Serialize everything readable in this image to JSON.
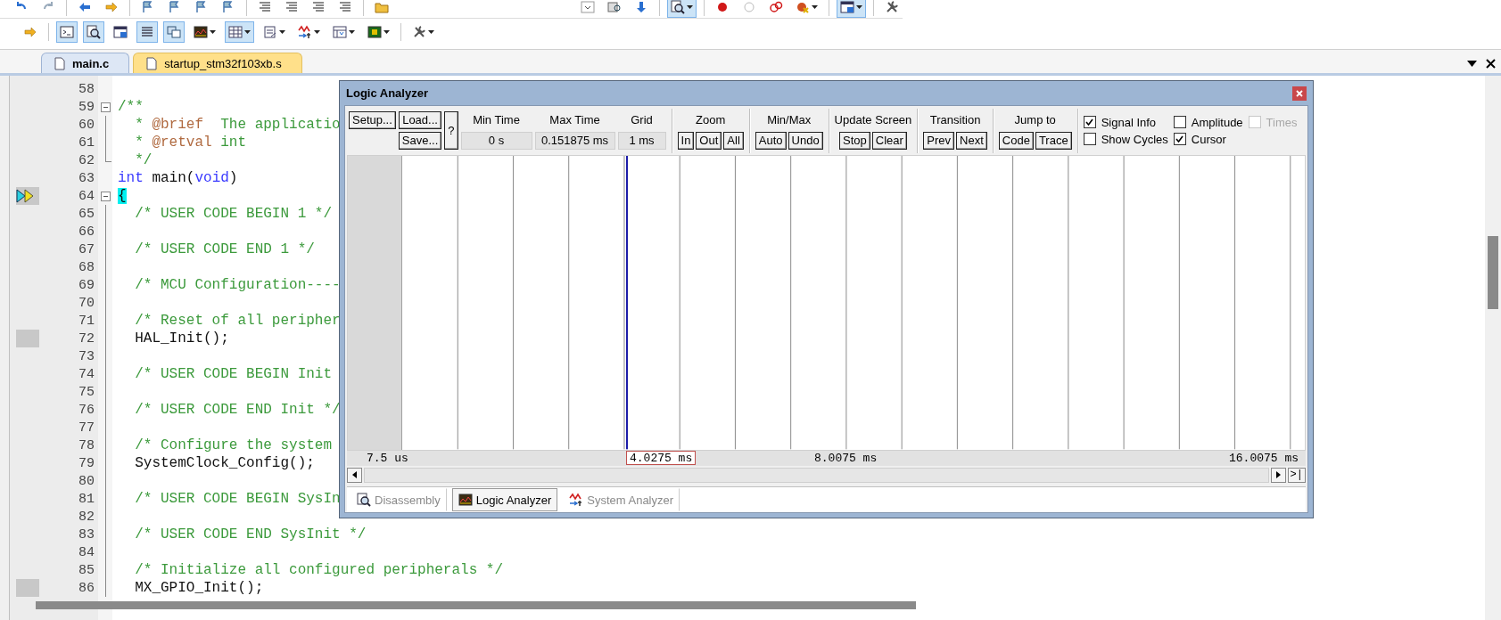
{
  "toolbar_top": {
    "left_groups": [
      [
        {
          "kind": "undo",
          "pressed": false
        },
        {
          "kind": "redo",
          "pressed": false
        }
      ],
      [
        {
          "kind": "back",
          "pressed": false
        },
        {
          "kind": "forward",
          "pressed": false
        }
      ],
      [
        {
          "kind": "flag",
          "pressed": false
        },
        {
          "kind": "flag",
          "pressed": false
        },
        {
          "kind": "flag",
          "pressed": false
        },
        {
          "kind": "flag",
          "pressed": false
        }
      ],
      [
        {
          "kind": "indent",
          "pressed": false
        },
        {
          "kind": "indent",
          "pressed": false
        },
        {
          "kind": "comment",
          "pressed": false
        },
        {
          "kind": "comment",
          "pressed": false
        }
      ],
      [
        {
          "kind": "folder",
          "pressed": false
        }
      ]
    ],
    "right_groups": [
      [
        {
          "kind": "combo",
          "pressed": false
        },
        {
          "kind": "find",
          "pressed": false
        },
        {
          "kind": "down",
          "pressed": false
        }
      ],
      [
        {
          "kind": "magnifier",
          "pressed": true,
          "dropdown": true
        }
      ],
      [
        {
          "kind": "dot",
          "pressed": false
        },
        {
          "kind": "ring",
          "pressed": false
        },
        {
          "kind": "rings",
          "pressed": false
        },
        {
          "kind": "bug",
          "pressed": false,
          "dropdown": true
        }
      ],
      [
        {
          "kind": "window",
          "pressed": true,
          "dropdown": true
        }
      ],
      [
        {
          "kind": "wrench",
          "pressed": false
        }
      ]
    ]
  },
  "toolbar_debug": [
    [
      {
        "kind": "forward",
        "pressed": false
      }
    ],
    [
      {
        "kind": "terminal",
        "pressed": true
      },
      {
        "kind": "magnifier",
        "pressed": true
      },
      {
        "kind": "window",
        "pressed": false
      },
      {
        "kind": "list",
        "pressed": true
      },
      {
        "kind": "windows",
        "pressed": true
      },
      {
        "kind": "chart",
        "pressed": false,
        "dropdown": true
      },
      {
        "kind": "grid",
        "pressed": true,
        "dropdown": true
      },
      {
        "kind": "document",
        "pressed": false,
        "dropdown": true
      },
      {
        "kind": "wave",
        "pressed": false,
        "dropdown": true
      },
      {
        "kind": "table",
        "pressed": false,
        "dropdown": true
      },
      {
        "kind": "chip",
        "pressed": false,
        "dropdown": true
      }
    ],
    [
      {
        "kind": "wrench",
        "pressed": false,
        "dropdown": true
      }
    ]
  ],
  "editor_tabs": [
    {
      "label": "main.c",
      "selected": true
    },
    {
      "label": "startup_stm32f103xb.s",
      "selected": false
    }
  ],
  "code_lines": [
    {
      "number": "58",
      "kind": "plain"
    },
    {
      "number": "59",
      "kind": "fold-start",
      "segments": [
        {
          "kind": "comment",
          "text": "/**"
        }
      ]
    },
    {
      "number": "60",
      "kind": "fold-body",
      "segments": [
        {
          "kind": "comment",
          "text": "  * "
        },
        {
          "kind": "doc-tag",
          "text": "@brief"
        },
        {
          "kind": "comment",
          "text": "  The applicatio"
        }
      ]
    },
    {
      "number": "61",
      "kind": "fold-body",
      "segments": [
        {
          "kind": "comment",
          "text": "  * "
        },
        {
          "kind": "doc-tag",
          "text": "@retval"
        },
        {
          "kind": "comment",
          "text": " int"
        }
      ]
    },
    {
      "number": "62",
      "kind": "fold-end",
      "segments": [
        {
          "kind": "comment",
          "text": "  */"
        }
      ]
    },
    {
      "number": "63",
      "kind": "plain",
      "segments": [
        {
          "kind": "keyword",
          "text": "int"
        },
        {
          "kind": "plain",
          "text": " main("
        },
        {
          "kind": "keyword",
          "text": "void"
        },
        {
          "kind": "plain",
          "text": ")"
        }
      ]
    },
    {
      "number": "64",
      "current_line": true,
      "kind": "fold-start",
      "segments": [
        {
          "kind": "brace-match",
          "text": "{"
        }
      ]
    },
    {
      "number": "65",
      "kind": "fold-body",
      "segments": [
        {
          "kind": "comment",
          "text": "  /* USER CODE BEGIN 1 */"
        }
      ]
    },
    {
      "number": "66",
      "kind": "fold-body"
    },
    {
      "number": "67",
      "kind": "fold-body",
      "segments": [
        {
          "kind": "comment",
          "text": "  /* USER CODE END 1 */"
        }
      ]
    },
    {
      "number": "68",
      "kind": "fold-body"
    },
    {
      "number": "69",
      "kind": "fold-body",
      "segments": [
        {
          "kind": "comment",
          "text": "  /* MCU Configuration----"
        }
      ]
    },
    {
      "number": "70",
      "kind": "fold-body"
    },
    {
      "number": "71",
      "kind": "fold-body",
      "segments": [
        {
          "kind": "comment",
          "text": "  /* Reset of all peripher"
        }
      ]
    },
    {
      "number": "72",
      "executable": true,
      "kind": "fold-body",
      "segments": [
        {
          "kind": "plain",
          "text": "  HAL_Init();"
        }
      ]
    },
    {
      "number": "73",
      "kind": "fold-body"
    },
    {
      "number": "74",
      "kind": "fold-body",
      "segments": [
        {
          "kind": "comment",
          "text": "  /* USER CODE BEGIN Init"
        }
      ]
    },
    {
      "number": "75",
      "kind": "fold-body"
    },
    {
      "number": "76",
      "kind": "fold-body",
      "segments": [
        {
          "kind": "comment",
          "text": "  /* USER CODE END Init */"
        }
      ]
    },
    {
      "number": "77",
      "kind": "fold-body"
    },
    {
      "number": "78",
      "kind": "fold-body",
      "segments": [
        {
          "kind": "comment",
          "text": "  /* Configure the system"
        }
      ]
    },
    {
      "number": "79",
      "kind": "fold-body",
      "segments": [
        {
          "kind": "plain",
          "text": "  SystemClock_Config();"
        }
      ]
    },
    {
      "number": "80",
      "kind": "fold-body"
    },
    {
      "number": "81",
      "kind": "fold-body",
      "segments": [
        {
          "kind": "comment",
          "text": "  /* USER CODE BEGIN SysIn"
        }
      ]
    },
    {
      "number": "82",
      "kind": "fold-body"
    },
    {
      "number": "83",
      "kind": "fold-body",
      "segments": [
        {
          "kind": "comment",
          "text": "  /* USER CODE END SysInit */"
        }
      ]
    },
    {
      "number": "84",
      "kind": "fold-body"
    },
    {
      "number": "85",
      "kind": "fold-body",
      "segments": [
        {
          "kind": "comment",
          "text": "  /* Initialize all configured peripherals */"
        }
      ]
    },
    {
      "number": "86",
      "executable": true,
      "kind": "fold-body",
      "segments": [
        {
          "kind": "plain",
          "text": "  MX_GPIO_Init();"
        }
      ]
    }
  ],
  "logic_analyzer": {
    "title": "Logic Analyzer",
    "file_buttons": {
      "setup": "Setup...",
      "load": "Load...",
      "save": "Save...",
      "help": "?"
    },
    "readouts": [
      {
        "label": "Min Time",
        "value": "0 s"
      },
      {
        "label": "Max Time",
        "value": "0.151875 ms"
      },
      {
        "label": "Grid",
        "value": "1 ms"
      }
    ],
    "button_groups": [
      {
        "label": "Zoom",
        "buttons": [
          "In",
          "Out",
          "All"
        ]
      },
      {
        "label": "Min/Max",
        "buttons": [
          "Auto",
          "Undo"
        ]
      },
      {
        "label": "Update Screen",
        "buttons": [
          "Stop",
          "Clear"
        ]
      },
      {
        "label": "Transition",
        "buttons": [
          "Prev",
          "Next"
        ]
      },
      {
        "label": "Jump to",
        "buttons": [
          "Code",
          "Trace"
        ]
      }
    ],
    "options": [
      {
        "label": "Signal Info",
        "checked": true,
        "disabled": false
      },
      {
        "label": "Amplitude",
        "checked": false,
        "disabled": false
      },
      {
        "label": "Times",
        "checked": false,
        "disabled": true
      },
      {
        "label": "Show Cycles",
        "checked": false,
        "disabled": false
      },
      {
        "label": "Cursor",
        "checked": true,
        "disabled": false
      }
    ],
    "cursor": {
      "level": 0.248
    },
    "time_labels": [
      {
        "text": "7.5 us",
        "kind": "start"
      },
      {
        "text": "4.0275 ms",
        "kind": "cursor"
      },
      {
        "text": "8.0075 ms",
        "kind": "middle"
      },
      {
        "text": "16.0075 ms",
        "kind": "end"
      }
    ],
    "end_button": ">|",
    "tabs": [
      {
        "label": "Disassembly",
        "selected": false
      },
      {
        "label": "Logic Analyzer",
        "selected": true
      },
      {
        "label": "System Analyzer",
        "selected": false
      }
    ]
  }
}
